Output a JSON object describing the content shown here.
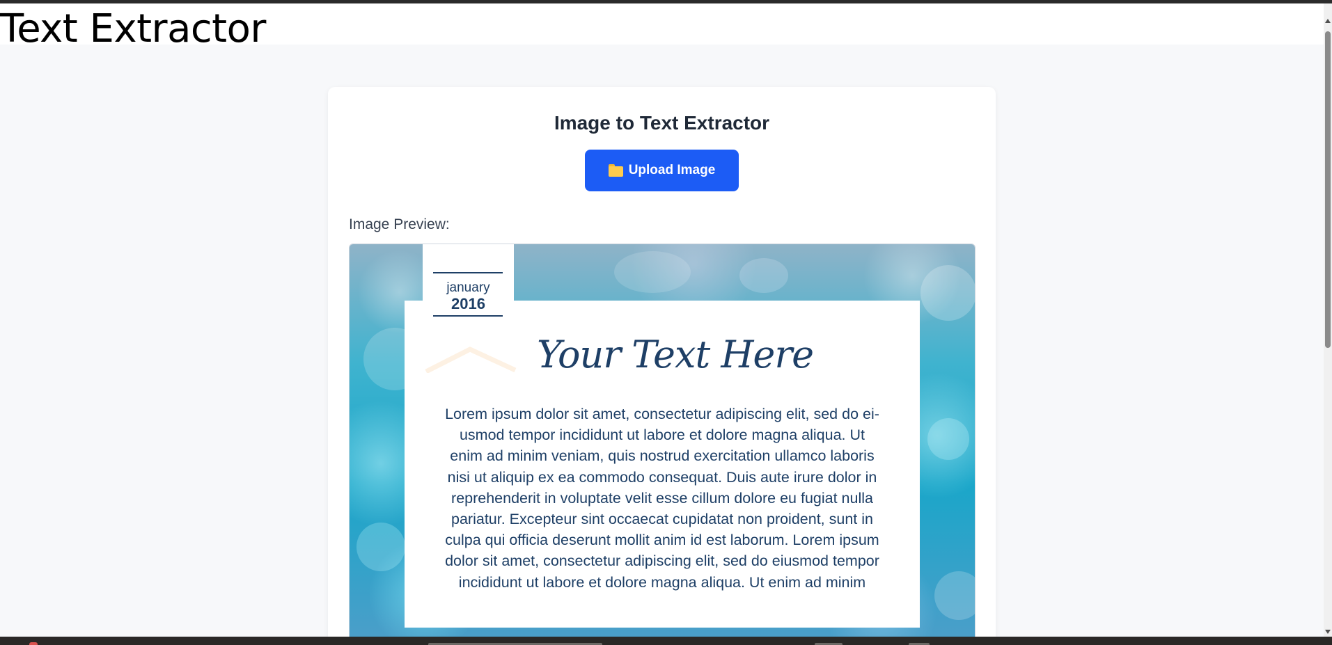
{
  "page": {
    "title": "Text Extractor"
  },
  "card": {
    "title": "Image to Text Extractor",
    "upload_button": {
      "icon": "folder-icon",
      "label": "Upload Image"
    },
    "preview_label": "Image Preview:"
  },
  "preview_image": {
    "date_month": "january",
    "date_year": "2016",
    "heading": "Your Text Here",
    "body_lines": [
      "Lorem ipsum dolor sit amet, consectetur adipiscing elit, sed do ei-",
      "usmod tempor incididunt ut labore et dolore magna aliqua. Ut",
      "enim ad minim veniam, quis nostrud exercitation ullamco laboris",
      "nisi ut aliquip ex ea commodo consequat. Duis aute irure dolor in",
      "reprehenderit in voluptate velit esse cillum dolore eu fugiat nulla",
      "pariatur. Excepteur sint occaecat cupidatat non proident, sunt in",
      "culpa qui officia deserunt mollit anim id est laborum. Lorem ipsum",
      "dolor sit amet, consectetur adipiscing elit, sed do eiusmod tempor",
      "incididunt ut labore et dolore magna aliqua. Ut enim ad minim"
    ]
  },
  "colors": {
    "accent": "#1c5cf5",
    "text_dark": "#1f2937",
    "navy": "#1e3f66",
    "page_bg": "#f7f8fa"
  }
}
